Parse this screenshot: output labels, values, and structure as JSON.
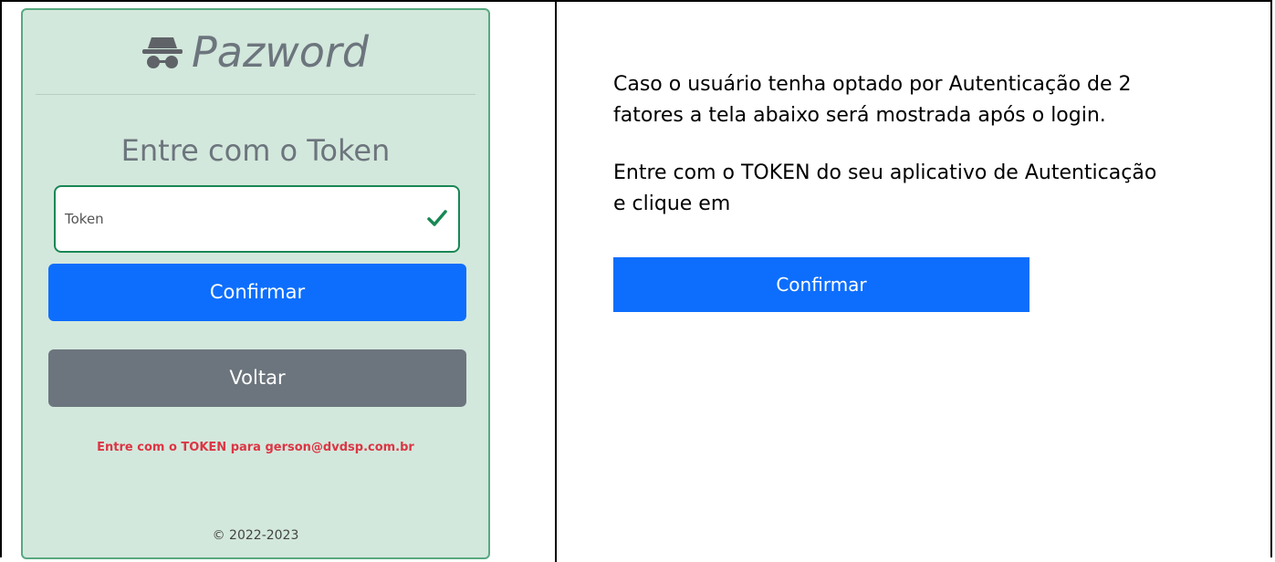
{
  "left_card": {
    "brand": "Pazword",
    "heading": "Entre com o Token",
    "token_placeholder": "Token",
    "confirm_label": "Confirmar",
    "back_label": "Voltar",
    "error_message": "Entre com o TOKEN para gerson@dvdsp.com.br",
    "footer": "© 2022-2023",
    "icon": "incognito-icon"
  },
  "right_panel": {
    "paragraph1_line1": "Caso o usuário tenha optado por Autenticação de 2",
    "paragraph1_line2": "fatores a tela abaixo será mostrada após o login.",
    "paragraph2_line1": "Entre com o TOKEN do seu aplicativo de Autenticação",
    "paragraph2_line2": "e clique em",
    "confirm_label": "Confirmar"
  },
  "colors": {
    "card_bg": "#d3e8dc",
    "primary": "#0d6efd",
    "secondary": "#6c757d",
    "success": "#198754",
    "danger": "#dc3545"
  }
}
